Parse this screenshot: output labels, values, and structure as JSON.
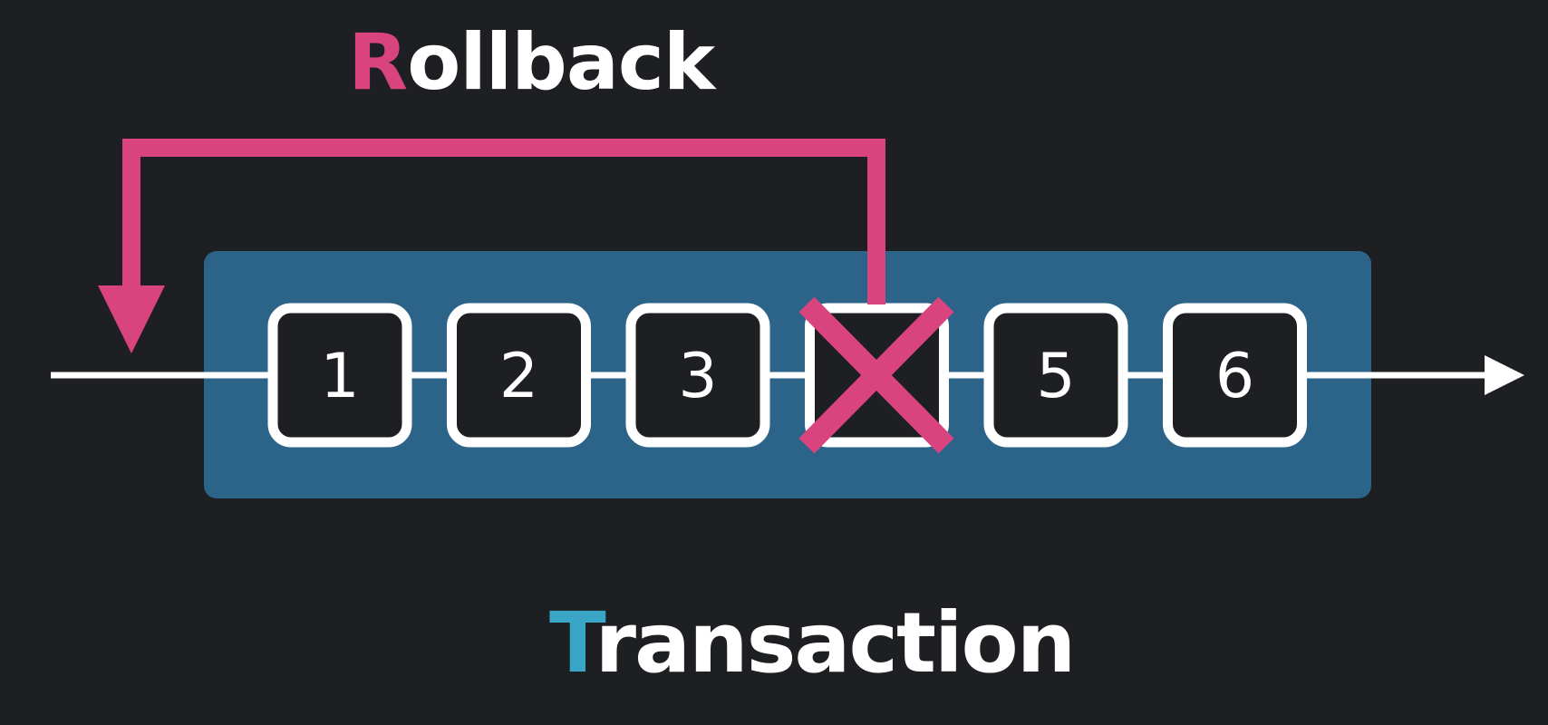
{
  "rollback": {
    "initial": "R",
    "rest": "ollback"
  },
  "transaction": {
    "initial": "T",
    "rest": "ransaction"
  },
  "steps": [
    {
      "label": "1",
      "failed": false
    },
    {
      "label": "2",
      "failed": false
    },
    {
      "label": "3",
      "failed": false
    },
    {
      "label": "",
      "failed": true
    },
    {
      "label": "5",
      "failed": false
    },
    {
      "label": "6",
      "failed": false
    }
  ],
  "colors": {
    "background": "#1e1f23",
    "transaction_box": "#2b6389",
    "step_fill": "#1e1f23",
    "step_border": "#ffffff",
    "line": "#ffffff",
    "rollback_accent": "#d9447f",
    "transaction_accent": "#3aa6c6",
    "text": "#ffffff"
  },
  "icons": {
    "failure_mark": "cross-icon",
    "flow_end": "arrow-right-icon",
    "rollback_end": "arrow-down-icon"
  }
}
